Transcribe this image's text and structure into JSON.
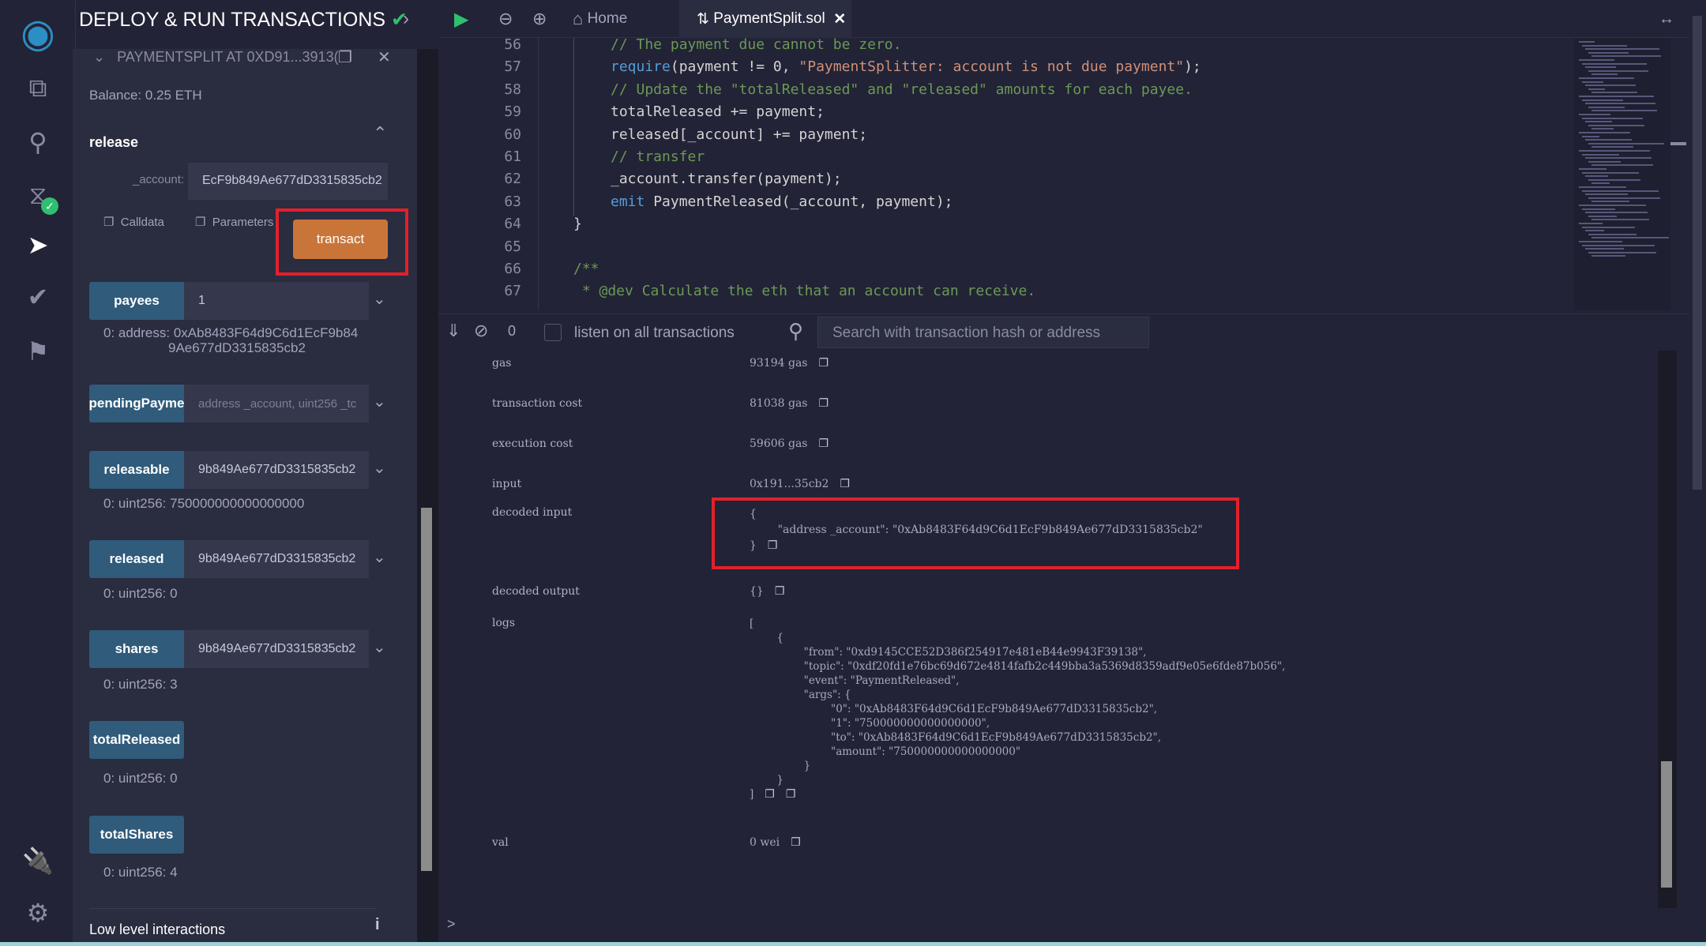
{
  "colors": {
    "accent_orange": "#c97539",
    "function_button": "#305b7b",
    "highlight_box": "#e3202b",
    "success": "#2fbf71"
  },
  "iconbar": {
    "icons": [
      "remix-logo-icon",
      "file-explorer-icon",
      "search-icon",
      "solidity-compiler-icon",
      "deploy-run-icon",
      "testing-icon",
      "learn-icon",
      "plugin-icon",
      "settings-icon"
    ]
  },
  "panel": {
    "title": "DEPLOY & RUN TRANSACTIONS",
    "instance_title": "PAYMENTSPLIT AT 0XD91...3913(",
    "balance": "Balance: 0.25 ETH",
    "release": {
      "label": "release",
      "account_label": "_account:",
      "account_value": "EcF9b849Ae677dD3315835cb2",
      "calldata": "Calldata",
      "parameters": "Parameters",
      "transact": "transact"
    },
    "functions": [
      {
        "name": "payees",
        "input": "1",
        "placeholder": "",
        "result": "0: address: 0xAb8483F64d9C6d1EcF9b84",
        "result2": "9Ae677dD3315835cb2"
      },
      {
        "name": "pendingPayme",
        "input": "",
        "placeholder": "address _account, uint256 _tc",
        "result": ""
      },
      {
        "name": "releasable",
        "input": "9b849Ae677dD3315835cb2",
        "result": "0: uint256: 750000000000000000"
      },
      {
        "name": "released",
        "input": "9b849Ae677dD3315835cb2",
        "result": "0: uint256: 0"
      },
      {
        "name": "shares",
        "input": "9b849Ae677dD3315835cb2",
        "result": "0: uint256: 3"
      },
      {
        "name": "totalReleased",
        "result": "0: uint256: 0"
      },
      {
        "name": "totalShares",
        "result": "0: uint256: 4"
      }
    ],
    "low_level": "Low level interactions"
  },
  "editor": {
    "tabs": {
      "home": "Home",
      "file": "PaymentSplit.sol"
    },
    "lines": [
      {
        "n": "56",
        "i": 2,
        "t": [
          [
            "c",
            "// The payment due cannot be zero."
          ]
        ]
      },
      {
        "n": "57",
        "i": 2,
        "t": [
          [
            "k",
            "require"
          ],
          [
            "",
            "(payment != 0, "
          ],
          [
            "s",
            "\"PaymentSplitter: account is not due payment\""
          ],
          [
            "",
            ");"
          ]
        ]
      },
      {
        "n": "58",
        "i": 2,
        "t": [
          [
            "c",
            "// Update the \"totalReleased\" and \"released\" amounts for each payee."
          ]
        ]
      },
      {
        "n": "59",
        "i": 2,
        "t": [
          [
            "",
            "totalReleased += payment;"
          ]
        ]
      },
      {
        "n": "60",
        "i": 2,
        "t": [
          [
            "",
            "released[_account] += payment;"
          ]
        ]
      },
      {
        "n": "61",
        "i": 2,
        "t": [
          [
            "c",
            "// transfer"
          ]
        ]
      },
      {
        "n": "62",
        "i": 2,
        "t": [
          [
            "",
            "_account.transfer(payment);"
          ]
        ]
      },
      {
        "n": "63",
        "i": 2,
        "t": [
          [
            "k",
            "emit"
          ],
          [
            "",
            " PaymentReleased(_account, payment);"
          ]
        ]
      },
      {
        "n": "64",
        "i": 1,
        "t": [
          [
            "",
            "}"
          ]
        ]
      },
      {
        "n": "65",
        "i": 1,
        "t": []
      },
      {
        "n": "66",
        "i": 1,
        "t": [
          [
            "c",
            "/**"
          ]
        ]
      },
      {
        "n": "67",
        "i": 1,
        "t": [
          [
            "c",
            " * @dev Calculate the eth that an account can receive."
          ]
        ]
      }
    ]
  },
  "terminal": {
    "count": "0",
    "listen_label": "listen on all transactions",
    "search_placeholder": "Search with transaction hash or address",
    "rows": {
      "gas": {
        "label": "gas",
        "value": "93194 gas"
      },
      "tx_cost": {
        "label": "transaction cost",
        "value": "81038 gas"
      },
      "exec_cost": {
        "label": "execution cost",
        "value": "59606 gas"
      },
      "input": {
        "label": "input",
        "value": "0x191...35cb2"
      },
      "decoded_input": {
        "label": "decoded input",
        "value": "{\n        \"address _account\": \"0xAb8483F64d9C6d1EcF9b849Ae677dD3315835cb2\"\n}"
      },
      "decoded_output": {
        "label": "decoded output",
        "value": "{}"
      },
      "logs": {
        "label": "logs",
        "value": "[\n        {\n                \"from\": \"0xd9145CCE52D386f254917e481eB44e9943F39138\",\n                \"topic\": \"0xdf20fd1e76bc69d672e4814fafb2c449bba3a5369d8359adf9e05e6fde87b056\",\n                \"event\": \"PaymentReleased\",\n                \"args\": {\n                        \"0\": \"0xAb8483F64d9C6d1EcF9b849Ae677dD3315835cb2\",\n                        \"1\": \"750000000000000000\",\n                        \"to\": \"0xAb8483F64d9C6d1EcF9b849Ae677dD3315835cb2\",\n                        \"amount\": \"750000000000000000\"\n                }\n        }\n]"
      },
      "val": {
        "label": "val",
        "value": "0 wei"
      }
    },
    "prompt": ">"
  }
}
